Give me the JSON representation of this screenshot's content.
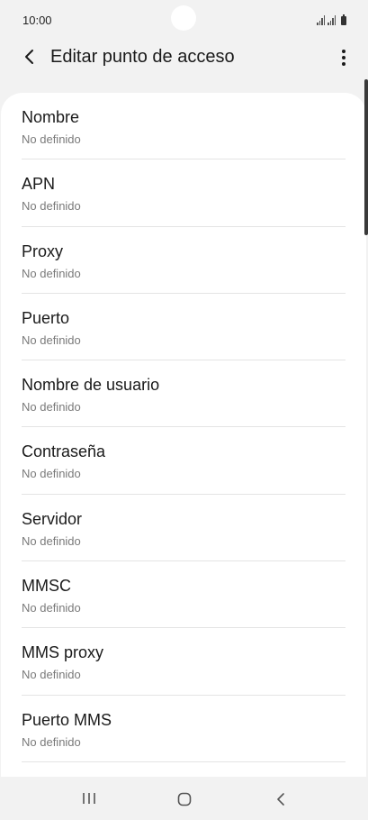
{
  "status_bar": {
    "time": "10:00"
  },
  "app_bar": {
    "title": "Editar punto de acceso",
    "back_icon": "back-arrow-icon",
    "more_icon": "more-vert-icon"
  },
  "settings": {
    "items": [
      {
        "label": "Nombre",
        "value": "No definido"
      },
      {
        "label": "APN",
        "value": "No definido"
      },
      {
        "label": "Proxy",
        "value": "No definido"
      },
      {
        "label": "Puerto",
        "value": "No definido"
      },
      {
        "label": "Nombre de usuario",
        "value": "No definido"
      },
      {
        "label": "Contraseña",
        "value": "No definido"
      },
      {
        "label": "Servidor",
        "value": "No definido"
      },
      {
        "label": "MMSC",
        "value": "No definido"
      },
      {
        "label": "MMS proxy",
        "value": "No definido"
      },
      {
        "label": "Puerto MMS",
        "value": "No definido"
      }
    ]
  },
  "nav_bar": {
    "recent_icon": "recent-apps-icon",
    "home_icon": "home-icon",
    "back_icon": "nav-back-icon"
  }
}
